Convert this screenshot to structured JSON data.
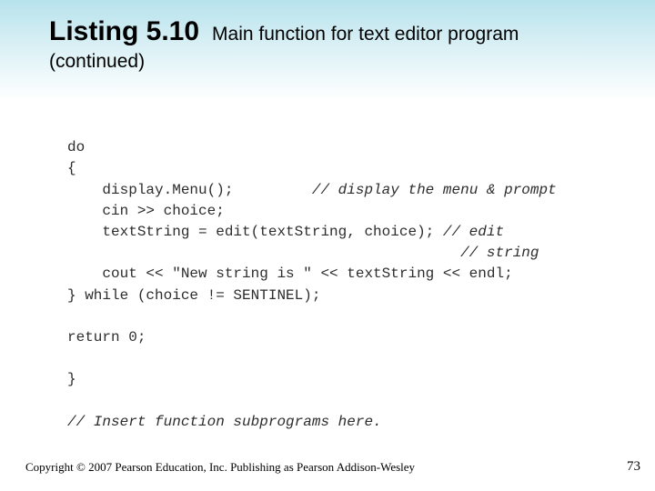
{
  "header": {
    "listing_label": "Listing 5.10",
    "listing_desc": "Main function for text editor program",
    "continued": "(continued)"
  },
  "code": {
    "l1": "do",
    "l2": "{",
    "l3a": "    display.Menu();",
    "l3b": "// display the menu & prompt",
    "l4": "    cin >> choice;",
    "l5a": "    textString = edit(textString, choice); ",
    "l5b": "// edit",
    "l6": "// string",
    "l7": "    cout << \"New string is \" << textString << endl;",
    "l8": "} while (choice != SENTINEL);",
    "l9": "return 0;",
    "l10": "}",
    "l11": "// Insert function subprograms here."
  },
  "footer": {
    "copyright": "Copyright © 2007 Pearson Education, Inc. Publishing as Pearson Addison-Wesley",
    "page": "73"
  }
}
